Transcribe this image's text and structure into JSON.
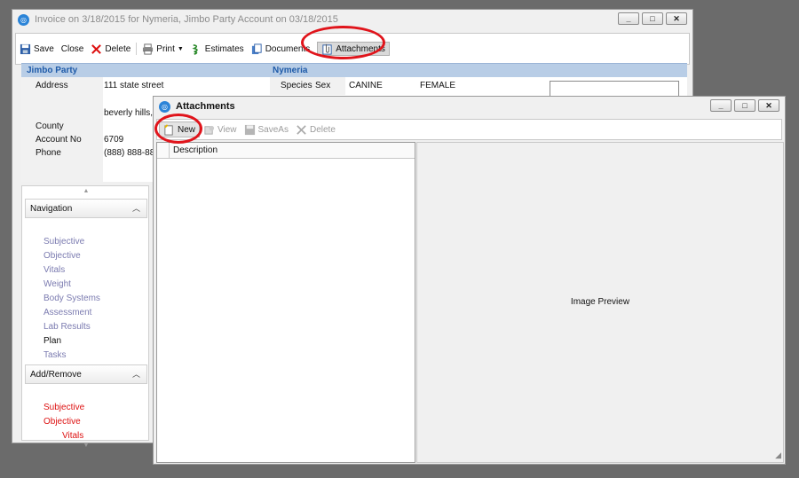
{
  "main_window": {
    "title": "Invoice on 3/18/2015 for Nymeria, Jimbo Party Account on 03/18/2015",
    "title_icon": "app-logo-icon",
    "window_buttons": [
      "_",
      "□",
      "✕"
    ],
    "toolbar": {
      "save": "Save",
      "close": "Close",
      "delete": "Delete",
      "print": "Print",
      "estimates": "Estimates",
      "documents": "Documents",
      "attachments": "Attachments"
    },
    "client": {
      "name": "Jimbo Party",
      "address_label": "Address",
      "address_line1": "111 state street",
      "address_line2": "beverly hills,",
      "county_label": "County",
      "account_label": "Account No",
      "account_value": "6709",
      "phone_label": "Phone",
      "phone_value": "(888) 888-88"
    },
    "patient": {
      "name": "Nymeria",
      "species_label": "Species",
      "sex_label": "Sex",
      "species_value": "CANINE",
      "sex_value": "FEMALE"
    },
    "navigation": {
      "header": "Navigation",
      "items": [
        {
          "label": "Subjective"
        },
        {
          "label": "Objective"
        },
        {
          "label": "Vitals"
        },
        {
          "label": "Weight"
        },
        {
          "label": "Body Systems"
        },
        {
          "label": "Assessment"
        },
        {
          "label": "Lab Results"
        },
        {
          "label": "Plan"
        },
        {
          "label": "Tasks"
        }
      ],
      "current_item": "Plan"
    },
    "add_remove": {
      "header": "Add/Remove",
      "items": [
        "Subjective",
        "Objective",
        "Vitals"
      ]
    }
  },
  "attachments_dialog": {
    "title": "Attachments",
    "window_buttons": [
      "_",
      "□",
      "✕"
    ],
    "toolbar": {
      "new": "New",
      "view": "View",
      "save_as": "SaveAs",
      "delete": "Delete"
    },
    "list": {
      "column_header": "Description"
    },
    "preview_label": "Image Preview"
  },
  "colors": {
    "highlight_ring": "#e0141b",
    "header_band": "#b8cde6",
    "header_text": "#1e5aa8",
    "nav_link": "#7b7bb0",
    "add_remove_link": "#dd1111"
  }
}
